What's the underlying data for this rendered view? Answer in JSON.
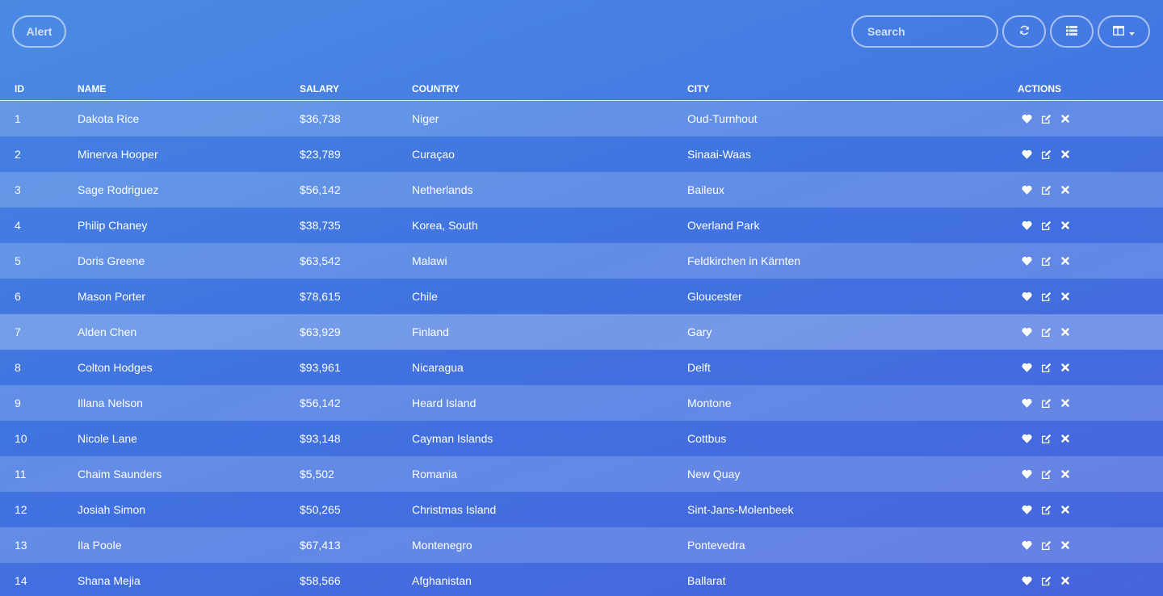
{
  "toolbar": {
    "alert_label": "Alert",
    "search_placeholder": "Search",
    "refresh_icon": "refresh-icon",
    "list_icon": "list-icon",
    "columns_icon": "columns-icon"
  },
  "colors": {
    "background_start": "#4a8ae3",
    "background_end": "#4a68de",
    "text": "#ffffff"
  },
  "table": {
    "headers": {
      "id": "ID",
      "name": "Name",
      "salary": "Salary",
      "country": "Country",
      "city": "City",
      "actions": "Actions"
    },
    "rows": [
      {
        "id": "1",
        "name": "Dakota Rice",
        "salary": "$36,738",
        "country": "Niger",
        "city": "Oud-Turnhout"
      },
      {
        "id": "2",
        "name": "Minerva Hooper",
        "salary": "$23,789",
        "country": "Curaçao",
        "city": "Sinaai-Waas"
      },
      {
        "id": "3",
        "name": "Sage Rodriguez",
        "salary": "$56,142",
        "country": "Netherlands",
        "city": "Baileux"
      },
      {
        "id": "4",
        "name": "Philip Chaney",
        "salary": "$38,735",
        "country": "Korea, South",
        "city": "Overland Park"
      },
      {
        "id": "5",
        "name": "Doris Greene",
        "salary": "$63,542",
        "country": "Malawi",
        "city": "Feldkirchen in Kärnten"
      },
      {
        "id": "6",
        "name": "Mason Porter",
        "salary": "$78,615",
        "country": "Chile",
        "city": "Gloucester"
      },
      {
        "id": "7",
        "name": "Alden Chen",
        "salary": "$63,929",
        "country": "Finland",
        "city": "Gary"
      },
      {
        "id": "8",
        "name": "Colton Hodges",
        "salary": "$93,961",
        "country": "Nicaragua",
        "city": "Delft"
      },
      {
        "id": "9",
        "name": "Illana Nelson",
        "salary": "$56,142",
        "country": "Heard Island",
        "city": "Montone"
      },
      {
        "id": "10",
        "name": "Nicole Lane",
        "salary": "$93,148",
        "country": "Cayman Islands",
        "city": "Cottbus"
      },
      {
        "id": "11",
        "name": "Chaim Saunders",
        "salary": "$5,502",
        "country": "Romania",
        "city": "New Quay"
      },
      {
        "id": "12",
        "name": "Josiah Simon",
        "salary": "$50,265",
        "country": "Christmas Island",
        "city": "Sint-Jans-Molenbeek"
      },
      {
        "id": "13",
        "name": "Ila Poole",
        "salary": "$67,413",
        "country": "Montenegro",
        "city": "Pontevedra"
      },
      {
        "id": "14",
        "name": "Shana Mejia",
        "salary": "$58,566",
        "country": "Afghanistan",
        "city": "Ballarat"
      }
    ],
    "row_actions": [
      "heart-icon",
      "edit-icon",
      "close-icon"
    ]
  }
}
